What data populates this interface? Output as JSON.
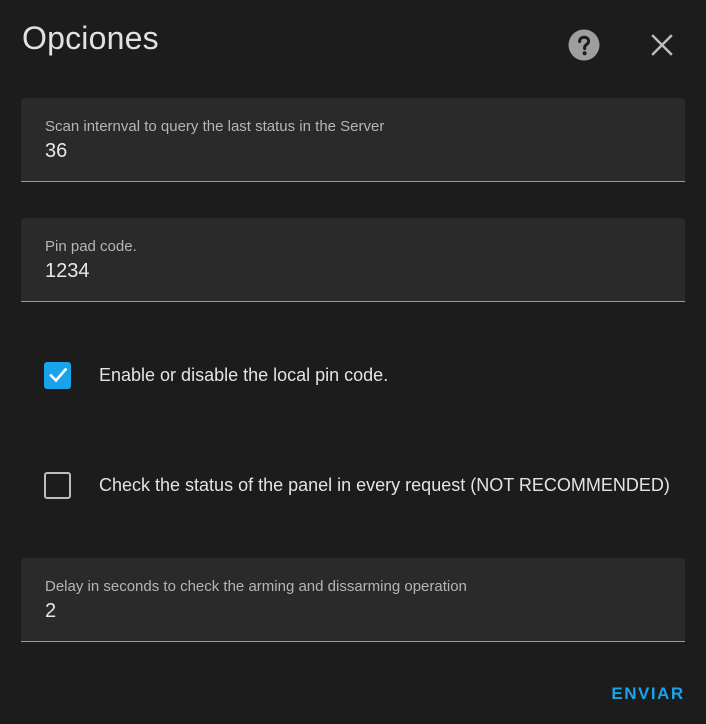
{
  "dialog": {
    "title": "Opciones",
    "help_icon": "help-circle-icon",
    "close_icon": "close-icon"
  },
  "fields": [
    {
      "label": "Scan internval to query the last status in the Server",
      "value": "36"
    },
    {
      "label": "Pin pad code.",
      "value": "1234"
    },
    {
      "label": "Delay in seconds to check the arming and dissarming operation",
      "value": "2"
    }
  ],
  "checkboxes": [
    {
      "label": "Enable or disable the local pin code.",
      "checked": true
    },
    {
      "label": "Check the status of the panel in every request (NOT RECOMMENDED)",
      "checked": false
    }
  ],
  "actions": {
    "submit_label": "ENVIAR"
  },
  "colors": {
    "background": "#1c1c1c",
    "field_background": "#2a2a2a",
    "accent": "#1aa3e8",
    "text": "#e1e1e1",
    "label": "#b5b5b5"
  }
}
